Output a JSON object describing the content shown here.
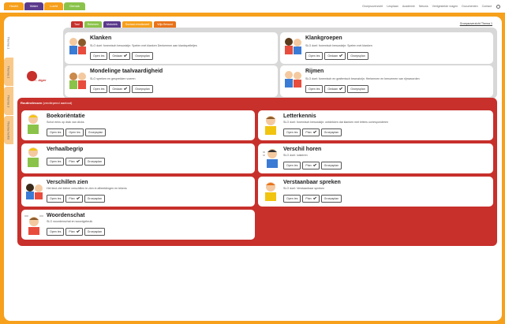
{
  "nav": {
    "tabs": [
      {
        "label": "Hoofd",
        "color": "#f6a01c"
      },
      {
        "label": "Water",
        "color": "#5b3a8c"
      },
      {
        "label": "Lucht",
        "color": "#f6a01c"
      },
      {
        "label": "Gemak",
        "color": "#8bc34a"
      }
    ],
    "links": [
      "Groepsoverzicht",
      "Lesplaan",
      "Academie",
      "Nieuws",
      "Veelgestelde vragen",
      "Documenten",
      "Contact"
    ]
  },
  "side_tabs": [
    "Thema 1",
    "Thema 2",
    "Thema 3",
    "Thema herfst"
  ],
  "logo": {
    "text": "... Alger"
  },
  "filters": [
    {
      "label": "Taal",
      "color": "#c7302b"
    },
    {
      "label": "Rekenen",
      "color": "#8bc34a"
    },
    {
      "label": "Motoriek",
      "color": "#5b3a8c"
    },
    {
      "label": "Sociaal-emotioneel",
      "color": "#f6a01c"
    },
    {
      "label": "Wijs Bewust",
      "color": "#e8731a"
    }
  ],
  "overview_link": "Groepsoverzicht Thema 1",
  "routine": {
    "title": "Routinelessen",
    "subtitle": "(verdiepend aanbod)"
  },
  "cards": [
    {
      "title": "Klanken",
      "desc": "SLO doel: fonemisch bewustzijn: Spelen met klanken Denkermen aan klankspelletjes",
      "buttons": [
        "Open les",
        "Gedaan",
        "Groepsplan"
      ]
    },
    {
      "title": "Klankgroepen",
      "desc": "SLO doel: fonemisch bewustzijn: Spelen met klanken",
      "buttons": [
        "Open les",
        "Gedaan",
        "Groepsplan"
      ]
    },
    {
      "title": "Mondelinge taalvaardigheid",
      "desc": "SLO spreken en gesprekken voeren",
      "buttons": [
        "Open les",
        "Gedaan",
        "Groepsplan"
      ]
    },
    {
      "title": "Rijmen",
      "desc": "SLO doel: fonemisch en grafemisch bewustzijn: Herkennen en benoemen van rijmwoorden",
      "buttons": [
        "Open les",
        "Gedaan",
        "Groepsplan"
      ]
    },
    {
      "title": "Boekoriëntatie",
      "desc": "Schot eens op drak van clicks",
      "buttons": [
        "Open les",
        "Open les",
        "Groepsplan"
      ]
    },
    {
      "title": "Letterkennis",
      "desc": "SLO doel: fonemisch bewustzijn: ontdekken dat klanken met letters corresponderen",
      "buttons": [
        "Open les",
        "Plan",
        "Groepsplan"
      ]
    },
    {
      "title": "Verhaalbegrip",
      "desc": "",
      "buttons": [
        "Open les",
        "Plan",
        "Groepsplan"
      ]
    },
    {
      "title": "Verschil horen",
      "desc": "SLO doel: luisteren",
      "buttons": [
        "Open les",
        "Plan",
        "Groepsplan"
      ]
    },
    {
      "title": "Verschillen zien",
      "desc": "Het kind ziet kleine verschillen te zien in afbeeldingen en tekens",
      "buttons": [
        "Open les",
        "Plan",
        "Groepsplan"
      ]
    },
    {
      "title": "Verstaanbaar spreken",
      "desc": "SLO doel: Verstaanbaar spreken",
      "buttons": [
        "Open les",
        "Plan",
        "Groepsplan"
      ]
    },
    {
      "title": "Woordenschat",
      "desc": "SLO woordenschat en woordgebruik",
      "buttons": [
        "Open les",
        "Plan",
        "Groepsplan"
      ]
    }
  ]
}
